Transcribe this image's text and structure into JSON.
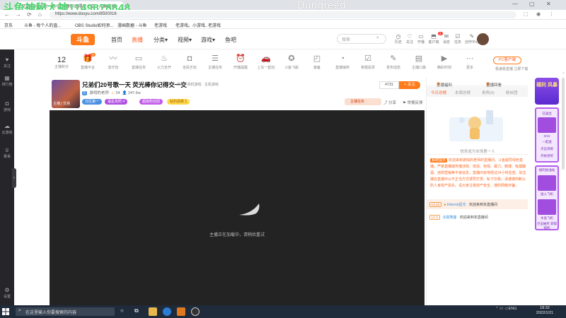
{
  "overlay": {
    "viewer_id": "斗鱼神秘大神1149878848",
    "title_text": "Dungreed"
  },
  "browser": {
    "tab_title": "兄弟们20号歌一天 荧光棒你记得交一交 - 斗鱼直播",
    "url": "https://www.douyu.com/8500016",
    "bookmarks": [
      "京东",
      "斗鱼 - 每个人的直...",
      "OBS Studio如何添...",
      "漫画数据 - 斗鱼",
      "老游戏",
      "老游戏。小游戏..",
      "老游戏"
    ]
  },
  "left_sidebar": {
    "items": [
      {
        "icon": "heart-icon",
        "label": "关注"
      },
      {
        "icon": "calendar-icon",
        "label": "排行榜"
      },
      {
        "icon": "gamepad-icon",
        "label": "游戏"
      },
      {
        "icon": "cloud-game-icon",
        "label": "云游戏"
      },
      {
        "icon": "trophy-icon",
        "label": "赛事"
      }
    ],
    "bottom_item": {
      "icon": "gear-icon",
      "label": "设置"
    }
  },
  "header": {
    "logo": "斗鱼",
    "nav": [
      {
        "label": "首页",
        "active": false
      },
      {
        "label": "直播",
        "active": true
      },
      {
        "label": "分类",
        "active": false,
        "dropdown": true
      },
      {
        "label": "视频",
        "active": false,
        "dropdown": true
      },
      {
        "label": "游戏",
        "active": false,
        "dropdown": true
      },
      {
        "label": "鱼吧",
        "active": false
      }
    ],
    "search_placeholder": "搜索",
    "icons": [
      {
        "icon": "history-icon",
        "label": "历史"
      },
      {
        "icon": "follow-icon",
        "label": "关注"
      },
      {
        "icon": "live-icon",
        "label": "开播"
      },
      {
        "icon": "client-icon",
        "label": "客户端"
      },
      {
        "icon": "message-icon",
        "label": "消息"
      },
      {
        "icon": "task-icon",
        "label": "任务"
      },
      {
        "icon": "creator-icon",
        "label": "创作中心"
      }
    ],
    "message_badge": "2"
  },
  "category_strip": {
    "rank_number": "12",
    "rank_label": "主播积分",
    "items": [
      {
        "icon": "gift-icon",
        "label": "直播平台",
        "badge": "2"
      },
      {
        "icon": "wave-icon",
        "label": "音乐包"
      },
      {
        "icon": "card-icon",
        "label": "直播任务"
      },
      {
        "icon": "fire-icon",
        "label": "火力全开"
      },
      {
        "icon": "gamepad-icon",
        "label": "全民乐玩"
      },
      {
        "icon": "list-icon",
        "label": "主播任务"
      },
      {
        "icon": "clock-icon",
        "label": "开播提醒"
      },
      {
        "icon": "car-icon",
        "label": "上车一起玩"
      },
      {
        "icon": "ufo-icon",
        "label": "斗鱼飞船"
      },
      {
        "icon": "bag-icon",
        "label": "装备"
      },
      {
        "icon": "dial-icon",
        "label": "直播抽奖"
      },
      {
        "icon": "vote-icon",
        "label": "答题投票"
      },
      {
        "icon": "edit-icon",
        "label": "发布动态"
      },
      {
        "icon": "shop-icon",
        "label": "主播口袋"
      },
      {
        "icon": "video-icon",
        "label": "精彩时刻"
      },
      {
        "icon": "more-icon",
        "label": "更多"
      }
    ],
    "pc_button": "PC客户端",
    "pc_sub": "极速看直播 立即下载"
  },
  "room": {
    "title": "兄弟们20号歌一天 荧光棒你记得交一交",
    "category": "单机 · 单机游戏 · 主机游戏",
    "level": "5",
    "streamer": "游戏的老师",
    "hot": "24",
    "viewers": "247.6w",
    "avatar_tag": "主播 | 交易",
    "badges": [
      {
        "label": "分区第一",
        "color": "#ffffff",
        "bg": "#4a90e2"
      },
      {
        "label": "福星高照  4",
        "color": "#ffffff",
        "bg": "#b04ee0"
      },
      {
        "label": "超级粉丝团",
        "color": "#ffffff",
        "bg": "#c05be8"
      },
      {
        "label": "钻石勋章 1",
        "color": "#a05a00",
        "bg": "#ffd84a"
      }
    ],
    "follow_count": "4731",
    "follow_label": "关注",
    "promo": "主播任务",
    "share": "分享",
    "report": "举报反馈"
  },
  "player": {
    "message": "主播正在加载中，请稍后重试"
  },
  "chat": {
    "tabs_top": [
      "主播福利",
      "直播回看"
    ],
    "tabs_rank": [
      {
        "label": "今日总榜",
        "active": true
      },
      {
        "label": "本周总榜",
        "active": false
      },
      {
        "label": "贵宾(0)",
        "active": false
      },
      {
        "label": "粉丝团",
        "active": false
      }
    ],
    "empty_text": "快来成为本场第一人",
    "sys_tag": "系统提示",
    "sys_text": "欢迎来到游戏的老师的直播间。斗鱼倡导绿色直播，严禁直播或传播涉政、低俗、色情、暴力、赌博、吸烟酗酒、违规营销等不良信息，直播内容将经过24小时巡查。如主播在直播中以不正当方式诱导打赏、私下交易，请谨慎判断以防人身财产损失。请大家注意财产安全，谨防网络诈骗。",
    "lines": [
      {
        "level": "LV 11",
        "name": "Interest星光",
        "text": "欢迎来到本直播间",
        "highlight": true
      },
      {
        "level": "LV 9",
        "name": "北极熊猫",
        "text": "欢迎来到本直播间",
        "highlight": false
      }
    ]
  },
  "right_bar": {
    "top_label": "福利 风暴",
    "box1": [
      "已送出",
      "0/10",
      "一起送",
      "点击领取",
      "开始领奖"
    ],
    "box2": [
      "福利加油站",
      "送入飞机",
      "水晶飞机",
      "点击抽奖 获取福利"
    ]
  },
  "taskbar": {
    "search_placeholder": "在这里输入你要搜索的内容",
    "tray_lang": "ENG",
    "time": "18:32",
    "date": "2022/1/21"
  }
}
